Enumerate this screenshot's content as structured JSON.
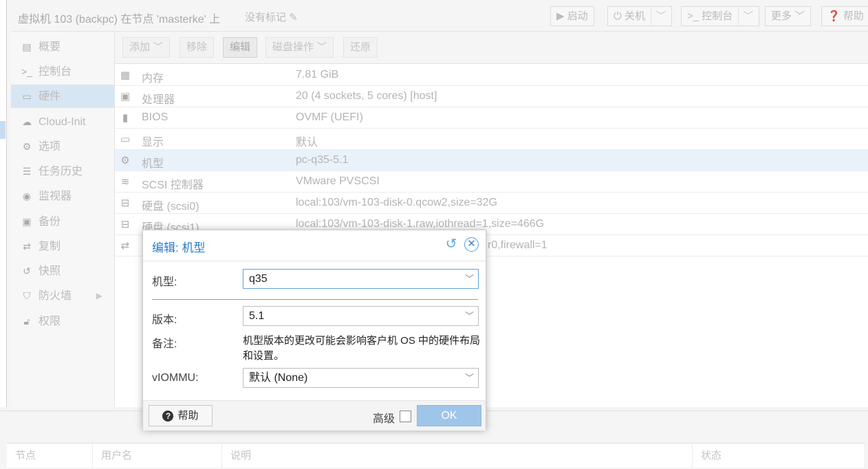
{
  "header": {
    "title": "虚拟机 103 (backpc) 在节点 'masterke' 上",
    "tags": "没有标记",
    "buttons": {
      "start": "启动",
      "shutdown": "关机",
      "console": "控制台",
      "more": "更多",
      "help": "帮助"
    }
  },
  "sidebar": {
    "items": [
      {
        "label": "概要",
        "icon": "book-icon"
      },
      {
        "label": "控制台",
        "icon": "terminal-icon"
      },
      {
        "label": "硬件",
        "icon": "desktop-icon",
        "active": true
      },
      {
        "label": "Cloud-Init",
        "icon": "cloud-icon"
      },
      {
        "label": "选项",
        "icon": "gear-icon"
      },
      {
        "label": "任务历史",
        "icon": "list-icon"
      },
      {
        "label": "监视器",
        "icon": "eye-icon"
      },
      {
        "label": "备份",
        "icon": "floppy-icon"
      },
      {
        "label": "复制",
        "icon": "retweet-icon"
      },
      {
        "label": "快照",
        "icon": "history-icon"
      },
      {
        "label": "防火墙",
        "icon": "shield-icon"
      },
      {
        "label": "权限",
        "icon": "unlock-icon"
      }
    ]
  },
  "toolbar": {
    "add": "添加",
    "remove": "移除",
    "edit": "编辑",
    "disk_action": "磁盘操作",
    "revert": "还原"
  },
  "hardware": [
    {
      "key": "内存",
      "value": "7.81 GiB",
      "icon": "memory-icon"
    },
    {
      "key": "处理器",
      "value": "20 (4 sockets, 5 cores) [host]",
      "icon": "cpu-icon"
    },
    {
      "key": "BIOS",
      "value": "OVMF (UEFI)",
      "icon": "chip-icon"
    },
    {
      "key": "显示",
      "value": "默认",
      "icon": "monitor-icon"
    },
    {
      "key": "机型",
      "value": "pc-q35-5.1",
      "icon": "cogs-icon",
      "selected": true
    },
    {
      "key": "SCSI 控制器",
      "value": "VMware PVSCSI",
      "icon": "database-icon"
    },
    {
      "key": "硬盘 (scsi0)",
      "value": "local:103/vm-103-disk-0.qcow2,size=32G",
      "icon": "hdd-icon"
    },
    {
      "key": "硬盘 (scsi1)",
      "value": "local:103/vm-103-disk-1.raw,iothread=1,size=466G",
      "icon": "hdd-icon"
    },
    {
      "key": "",
      "value": "r0,firewall=1",
      "icon": "exchange-icon"
    }
  ],
  "tasklog": {
    "columns": [
      "节点",
      "用户名",
      "说明",
      "状态"
    ]
  },
  "dialog": {
    "title": "编辑: 机型",
    "machine_label": "机型:",
    "machine_value": "q35",
    "version_label": "版本:",
    "version_value": "5.1",
    "note_label": "备注:",
    "note_text": "机型版本的更改可能会影响客户机 OS 中的硬件布局和设置。",
    "viommu_label": "vIOMMU:",
    "viommu_value": "默认 (None)",
    "help": "帮助",
    "advanced": "高级",
    "ok": "OK"
  }
}
